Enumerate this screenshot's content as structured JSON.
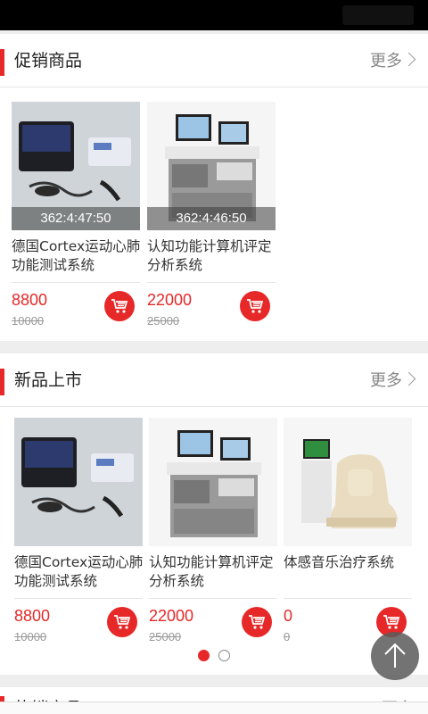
{
  "sections": {
    "promo": {
      "title": "促销商品",
      "more": "更多",
      "products": [
        {
          "name": "德国Cortex运动心肺功能测试系统",
          "timer": "362:4:47:50",
          "price": "8800",
          "old_price": "10000"
        },
        {
          "name": "认知功能计算机评定分析系统",
          "timer": "362:4:46:50",
          "price": "22000",
          "old_price": "25000"
        }
      ]
    },
    "new": {
      "title": "新品上市",
      "more": "更多",
      "products": [
        {
          "name": "德国Cortex运动心肺功能测试系统",
          "price": "8800",
          "old_price": "10000"
        },
        {
          "name": "认知功能计算机评定分析系统",
          "price": "22000",
          "old_price": "25000"
        },
        {
          "name": "体感音乐治疗系统",
          "price": "0",
          "old_price": "0"
        }
      ]
    },
    "hot": {
      "title": "热销商品",
      "more": "更多"
    }
  },
  "carousel": {
    "pages": 2,
    "active": 1
  },
  "icons": {
    "cart": "cart-icon",
    "back_to_top": "arrow-up-icon",
    "more": "chevron-right-icon"
  },
  "colors": {
    "accent": "#e62828"
  }
}
